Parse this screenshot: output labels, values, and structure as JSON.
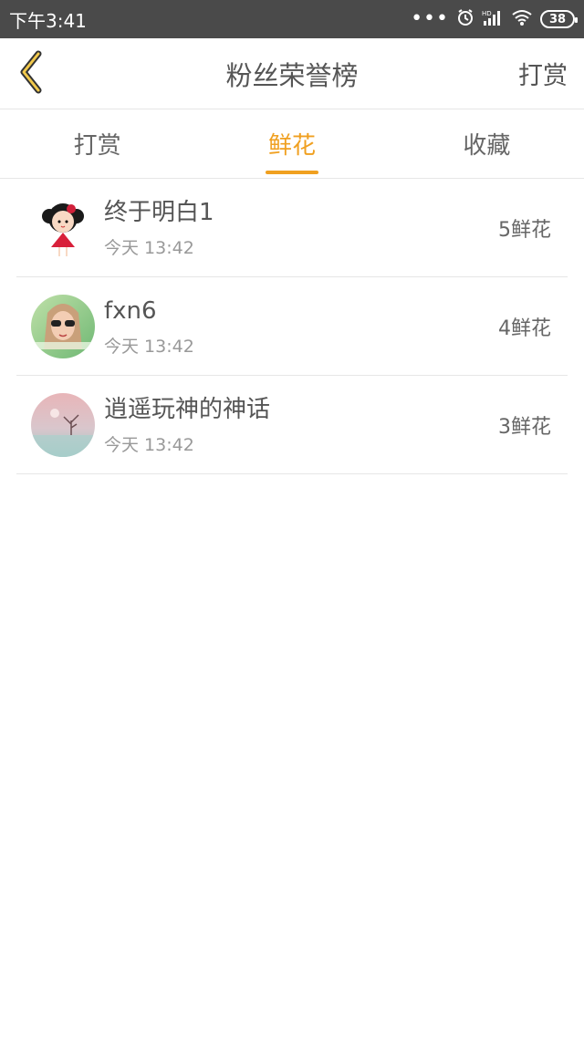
{
  "status_bar": {
    "time": "下午3:41",
    "dots": "•••",
    "battery": "38"
  },
  "header": {
    "title": "粉丝荣誉榜",
    "action": "打赏"
  },
  "tabs": [
    {
      "label": "打赏"
    },
    {
      "label": "鲜花"
    },
    {
      "label": "收藏"
    }
  ],
  "active_tab_index": 1,
  "list": [
    {
      "name": "终于明白1",
      "time": "今天 13:42",
      "count": "5鲜花",
      "avatar": "cartoon-girl-avatar"
    },
    {
      "name": "fxn6",
      "time": "今天 13:42",
      "count": "4鲜花",
      "avatar": "photo-avatar"
    },
    {
      "name": "逍遥玩神的神话",
      "time": "今天 13:42",
      "count": "3鲜花",
      "avatar": "landscape-avatar"
    }
  ],
  "colors": {
    "accent": "#f0a020",
    "status_bar": "#4a4a4a",
    "text": "#555555",
    "subtext": "#999999",
    "divider": "#e6e6e6"
  }
}
